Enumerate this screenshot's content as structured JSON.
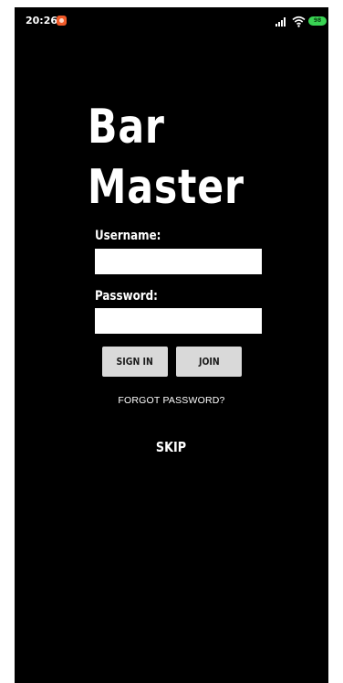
{
  "status_bar": {
    "time": "20:26",
    "battery": "98",
    "icons": [
      "app-notification-icon",
      "signal-icon",
      "wifi-icon",
      "battery-icon"
    ]
  },
  "title": {
    "line1": "Bar",
    "line2": "Master"
  },
  "form": {
    "username_label": "Username:",
    "username_value": "",
    "password_label": "Password:",
    "password_value": ""
  },
  "buttons": {
    "sign_in": "SIGN IN",
    "join": "JOIN"
  },
  "links": {
    "forgot_password": "FORGOT PASSWORD?",
    "skip": "SKIP"
  },
  "colors": {
    "background": "#000000",
    "text": "#ffffff",
    "button_bg": "#d9d9d9",
    "battery": "#39d353",
    "notification": "#f05a28"
  }
}
